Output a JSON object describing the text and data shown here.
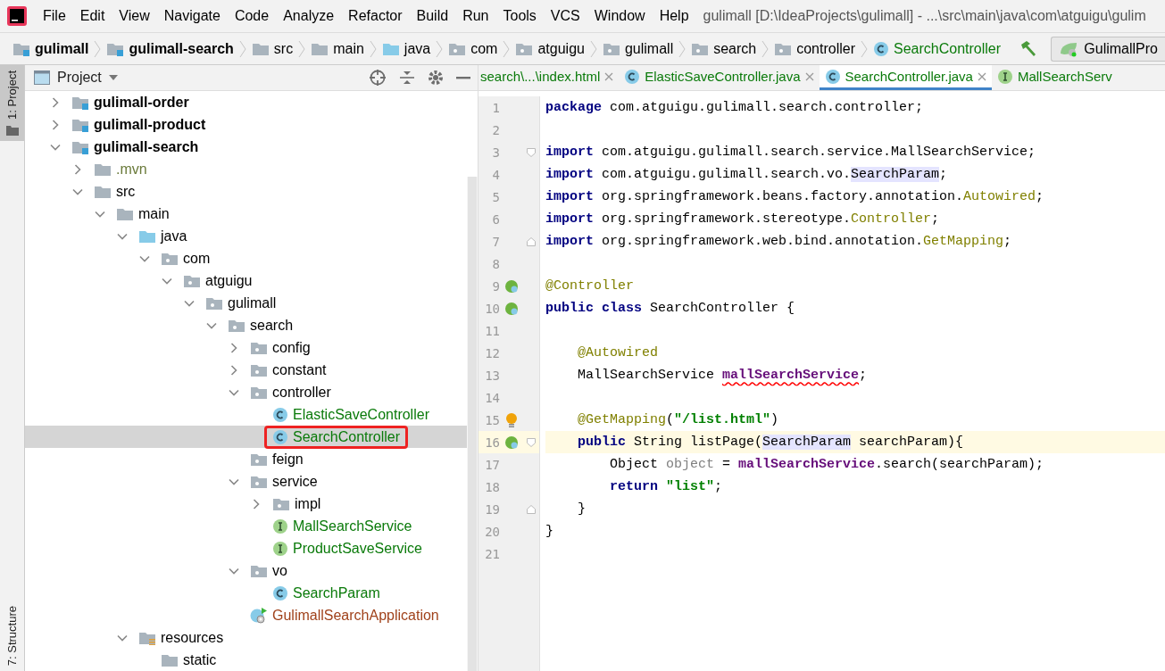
{
  "menu": [
    "File",
    "Edit",
    "View",
    "Navigate",
    "Code",
    "Analyze",
    "Refactor",
    "Build",
    "Run",
    "Tools",
    "VCS",
    "Window",
    "Help"
  ],
  "window": {
    "title": "gulimall [D:\\IdeaProjects\\gulimall] - ...\\src\\main\\java\\com\\atguigu\\gulim"
  },
  "breadcrumb": [
    {
      "label": "gulimall",
      "kind": "module"
    },
    {
      "label": "gulimall-search",
      "kind": "module"
    },
    {
      "label": "src",
      "kind": "folder"
    },
    {
      "label": "main",
      "kind": "folder"
    },
    {
      "label": "java",
      "kind": "srcfolder"
    },
    {
      "label": "com",
      "kind": "package"
    },
    {
      "label": "atguigu",
      "kind": "package"
    },
    {
      "label": "gulimall",
      "kind": "package"
    },
    {
      "label": "search",
      "kind": "package"
    },
    {
      "label": "controller",
      "kind": "package"
    },
    {
      "label": "SearchController",
      "kind": "class"
    }
  ],
  "run_config": {
    "label": "GulimallPro"
  },
  "tool_stripe": [
    {
      "label": "1: Project",
      "selected": true
    },
    {
      "label": "7: Structure",
      "selected": false
    }
  ],
  "project_panel": {
    "title": "Project",
    "tree": [
      {
        "label": "gulimall-order",
        "kind": "module",
        "expanded": false,
        "selected": false
      },
      {
        "label": "gulimall-product",
        "kind": "module",
        "expanded": false,
        "selected": false
      },
      {
        "label": "gulimall-search",
        "kind": "module",
        "expanded": true,
        "selected": false,
        "children": [
          {
            "label": ".mvn",
            "kind": "folder",
            "expanded": false,
            "selected": false
          },
          {
            "label": "src",
            "kind": "folder",
            "expanded": true,
            "selected": false,
            "children": [
              {
                "label": "main",
                "kind": "folder",
                "expanded": true,
                "selected": false,
                "children": [
                  {
                    "label": "java",
                    "kind": "srcfolder",
                    "expanded": true,
                    "selected": false,
                    "children": [
                      {
                        "label": "com",
                        "kind": "package",
                        "expanded": true,
                        "selected": false,
                        "children": [
                          {
                            "label": "atguigu",
                            "kind": "package",
                            "expanded": true,
                            "selected": false,
                            "children": [
                              {
                                "label": "gulimall",
                                "kind": "package",
                                "expanded": true,
                                "selected": false,
                                "children": [
                                  {
                                    "label": "search",
                                    "kind": "package",
                                    "expanded": true,
                                    "selected": false,
                                    "children": [
                                      {
                                        "label": "config",
                                        "kind": "package",
                                        "expanded": false,
                                        "selected": false
                                      },
                                      {
                                        "label": "constant",
                                        "kind": "package",
                                        "expanded": false,
                                        "selected": false
                                      },
                                      {
                                        "label": "controller",
                                        "kind": "package",
                                        "expanded": true,
                                        "selected": false,
                                        "children": [
                                          {
                                            "label": "ElasticSaveController",
                                            "kind": "class",
                                            "selected": false
                                          },
                                          {
                                            "label": "SearchController",
                                            "kind": "class",
                                            "selected": true,
                                            "highlighted": true
                                          }
                                        ]
                                      },
                                      {
                                        "label": "feign",
                                        "kind": "package",
                                        "selected": false
                                      },
                                      {
                                        "label": "service",
                                        "kind": "package",
                                        "expanded": true,
                                        "selected": false,
                                        "children": [
                                          {
                                            "label": "impl",
                                            "kind": "package",
                                            "expanded": false,
                                            "selected": false
                                          },
                                          {
                                            "label": "MallSearchService",
                                            "kind": "interface",
                                            "selected": false
                                          },
                                          {
                                            "label": "ProductSaveService",
                                            "kind": "interface",
                                            "selected": false
                                          }
                                        ]
                                      },
                                      {
                                        "label": "vo",
                                        "kind": "package",
                                        "expanded": true,
                                        "selected": false,
                                        "children": [
                                          {
                                            "label": "SearchParam",
                                            "kind": "class",
                                            "selected": false
                                          }
                                        ]
                                      },
                                      {
                                        "label": "GulimallSearchApplication",
                                        "kind": "app",
                                        "selected": false
                                      }
                                    ]
                                  }
                                ]
                              }
                            ]
                          }
                        ]
                      }
                    ]
                  },
                  {
                    "label": "resources",
                    "kind": "resfolder",
                    "expanded": true,
                    "selected": false,
                    "children": [
                      {
                        "label": "static",
                        "kind": "folder",
                        "selected": false
                      }
                    ]
                  }
                ]
              }
            ]
          }
        ]
      }
    ]
  },
  "editor_tabs": [
    {
      "label": "search\\...\\index.html",
      "selected": false
    },
    {
      "label": "ElasticSaveController.java",
      "kind": "class",
      "selected": false
    },
    {
      "label": "SearchController.java",
      "kind": "class",
      "selected": true
    },
    {
      "label": "MallSearchServ",
      "kind": "interface",
      "selected": false
    }
  ],
  "code": [
    {
      "n": "1",
      "tokens": [
        {
          "text": "package",
          "kind": "keyword"
        },
        {
          "text": " com.atguigu.gulimall.search.controller;",
          "kind": "plain"
        }
      ]
    },
    {
      "n": "2"
    },
    {
      "n": "3",
      "fold": {
        "kind": "start"
      },
      "tokens": [
        {
          "text": "import",
          "kind": "keyword"
        },
        {
          "text": " com.atguigu.gulimall.search.service.MallSearchService;",
          "kind": "plain"
        }
      ]
    },
    {
      "n": "4",
      "tokens": [
        {
          "text": "import",
          "kind": "keyword"
        },
        {
          "text": " com.atguigu.gulimall.search.vo.",
          "kind": "plain"
        },
        {
          "text": "SearchParam",
          "kind": "reference"
        },
        {
          "text": ";",
          "kind": "plain"
        }
      ]
    },
    {
      "n": "5",
      "tokens": [
        {
          "text": "import",
          "kind": "keyword"
        },
        {
          "text": " org.springframework.beans.factory.annotation.",
          "kind": "plain"
        },
        {
          "text": "Autowired",
          "kind": "annotation"
        },
        {
          "text": ";",
          "kind": "plain"
        }
      ]
    },
    {
      "n": "6",
      "tokens": [
        {
          "text": "import",
          "kind": "keyword"
        },
        {
          "text": " org.springframework.stereotype.",
          "kind": "plain"
        },
        {
          "text": "Controller",
          "kind": "annotation"
        },
        {
          "text": ";",
          "kind": "plain"
        }
      ]
    },
    {
      "n": "7",
      "fold": {
        "kind": "end"
      },
      "tokens": [
        {
          "text": "import",
          "kind": "keyword"
        },
        {
          "text": " org.springframework.web.bind.annotation.",
          "kind": "plain"
        },
        {
          "text": "GetMapping",
          "kind": "annotation"
        },
        {
          "text": ";",
          "kind": "plain"
        }
      ]
    },
    {
      "n": "8"
    },
    {
      "n": "9",
      "marker": {
        "kind": "bean"
      },
      "tokens": [
        {
          "text": "@Controller",
          "kind": "annotation"
        }
      ]
    },
    {
      "n": "10",
      "marker": {
        "kind": "bean"
      },
      "tokens": [
        {
          "text": "public class",
          "kind": "keyword"
        },
        {
          "text": " SearchController {",
          "kind": "plain"
        }
      ],
      "children": [
        {
          "n": "11"
        },
        {
          "n": "12",
          "tokens": [
            {
              "text": "@Autowired",
              "kind": "annotation"
            }
          ]
        },
        {
          "n": "13",
          "tokens": [
            {
              "text": "MallSearchService ",
              "kind": "plain"
            },
            {
              "text": "mallSearchService",
              "kind": "field_error"
            },
            {
              "text": ";",
              "kind": "plain"
            }
          ]
        },
        {
          "n": "14"
        },
        {
          "n": "15",
          "marker": {
            "kind": "bulb"
          },
          "tokens": [
            {
              "text": "@GetMapping",
              "kind": "annotation"
            },
            {
              "text": "(",
              "kind": "plain"
            },
            {
              "text": "\"/list.html\"",
              "kind": "string"
            },
            {
              "text": ")",
              "kind": "plain"
            }
          ]
        },
        {
          "n": "16",
          "marker": {
            "kind": "bean"
          },
          "fold": {
            "kind": "start"
          },
          "current": true,
          "tokens": [
            {
              "text": "public",
              "kind": "keyword"
            },
            {
              "text": " String listPage(",
              "kind": "plain"
            },
            {
              "text": "SearchParam",
              "kind": "reference"
            },
            {
              "text": " searchParam){",
              "kind": "plain"
            }
          ],
          "children": [
            {
              "n": "17",
              "tokens": [
                {
                  "text": "Object ",
                  "kind": "plain"
                },
                {
                  "text": "object",
                  "kind": "unused"
                },
                {
                  "text": " = ",
                  "kind": "plain"
                },
                {
                  "text": "mallSearchService",
                  "kind": "field"
                },
                {
                  "text": ".search(searchParam);",
                  "kind": "plain"
                }
              ]
            },
            {
              "n": "18",
              "tokens": [
                {
                  "text": "return ",
                  "kind": "keyword"
                },
                {
                  "text": "\"list\"",
                  "kind": "string"
                },
                {
                  "text": ";",
                  "kind": "plain"
                }
              ]
            }
          ]
        },
        {
          "n": "19",
          "fold": {
            "kind": "end"
          },
          "tokens": [
            {
              "text": "}",
              "kind": "plain"
            }
          ]
        }
      ]
    },
    {
      "n": "20",
      "tokens": [
        {
          "text": "}",
          "kind": "plain"
        }
      ]
    },
    {
      "n": "21"
    }
  ]
}
